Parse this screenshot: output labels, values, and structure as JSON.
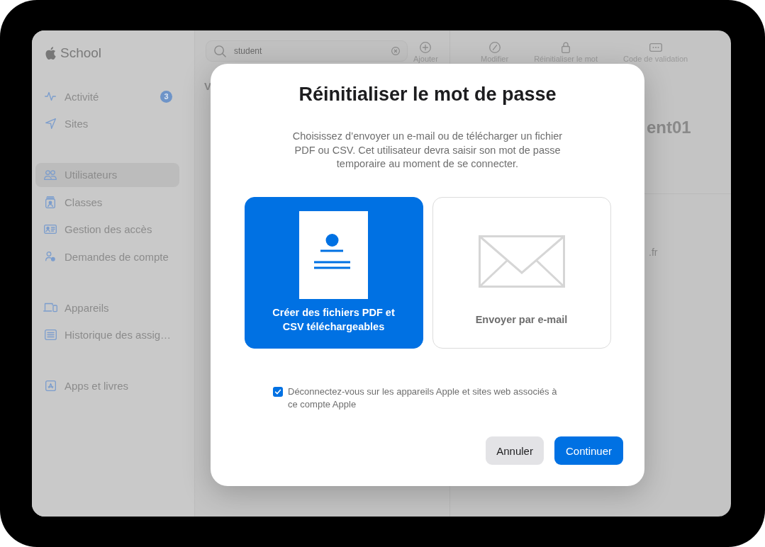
{
  "sidebar": {
    "app_name": "School",
    "groups": [
      {
        "items": [
          {
            "label": "Activité",
            "selected": false,
            "badge": "3"
          },
          {
            "label": "Sites",
            "selected": false
          }
        ]
      },
      {
        "items": [
          {
            "label": "Utilisateurs",
            "selected": true
          },
          {
            "label": "Classes",
            "selected": false
          },
          {
            "label": "Gestion des accès",
            "selected": false
          },
          {
            "label": "Demandes de compte",
            "selected": false
          }
        ]
      },
      {
        "items": [
          {
            "label": "Appareils",
            "selected": false
          },
          {
            "label": "Historique des assig…",
            "selected": false
          }
        ]
      },
      {
        "items": [
          {
            "label": "Apps et livres",
            "selected": false
          }
        ]
      }
    ]
  },
  "list_panel": {
    "search": {
      "value": "student"
    },
    "actions": [
      {
        "label": "Ajouter"
      }
    ],
    "heading": "V"
  },
  "detail_panel": {
    "actions": [
      {
        "label": "Modifier"
      },
      {
        "label": "Réinitialiser le mot"
      },
      {
        "label": "Code de validation"
      }
    ],
    "title": "ent01",
    "detail_text": ".fr"
  },
  "dialog": {
    "title": "Réinitialiser le mot de passe",
    "message": "Choisissez d’envoyer un e-mail ou de télécharger un fichier PDF ou CSV. Cet utilisateur devra saisir son mot de passe temporaire au moment de se connecter.",
    "options": [
      {
        "label": "Créer des fichiers PDF et CSV téléchargeables",
        "selected": true
      },
      {
        "label": "Envoyer par e-mail",
        "selected": false
      }
    ],
    "checkbox": {
      "label": "Déconnectez-vous sur les appareils Apple et sites web associés à ce compte Apple",
      "checked": true
    },
    "buttons": [
      {
        "label": "Annuler",
        "kind": "secondary"
      },
      {
        "label": "Continuer",
        "kind": "primary"
      }
    ]
  }
}
